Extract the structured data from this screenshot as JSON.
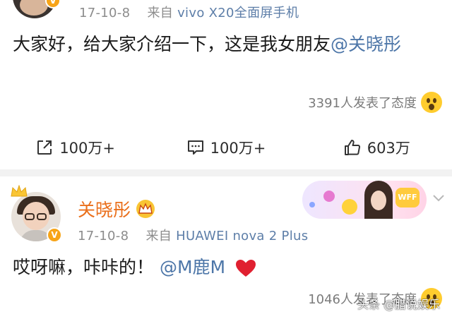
{
  "post1": {
    "date": "17-10-8",
    "from_prefix": "来自",
    "device": "vivo X20全面屏手机",
    "content_text": "大家好，给大家介绍一下，这是我女朋友",
    "mention": "@关晓彤",
    "reactions_text": "3391人发表了态度",
    "reaction_icon": "surprised-emoji-icon",
    "actions": {
      "share_count": "100万+",
      "comment_count": "100万+",
      "like_count": "603万"
    }
  },
  "post2": {
    "username": "关晓彤",
    "vip_badge_icon": "crown-badge-icon",
    "date": "17-10-8",
    "from_prefix": "来自",
    "device": "HUAWEI nova 2 Plus",
    "content_text": "哎呀嘛，咔咔的！",
    "mention": "@M鹿M",
    "reactions_text": "1046人发表了态度",
    "banner_label": "WFF"
  },
  "watermark": "头条 @腊说娱乐",
  "colors": {
    "mention": "#4d76a8",
    "username": "#ea6f1b",
    "verified_badge": "#f7a418",
    "separator": "#f2f2f2"
  }
}
